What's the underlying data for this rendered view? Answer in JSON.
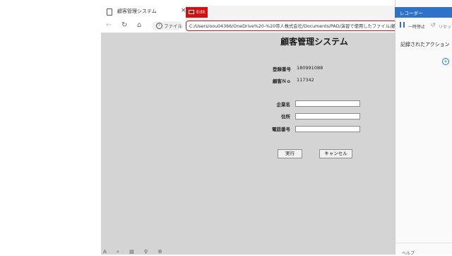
{
  "browser": {
    "tab_title": "顧客管理システム",
    "tab_close_glyph": "×",
    "edit_label": "Edit",
    "file_label": "ファイル",
    "info_glyph": "i",
    "address": "C:/Users/oou04366/OneDrive%20-%20帝人株式会社/Documents/PAD/演習で使用したファイル/顧",
    "back_glyph": "←",
    "reload_glyph": "↻",
    "home_glyph": "⌂"
  },
  "form": {
    "title": "顧客管理システム",
    "reg_number_label": "登録番号",
    "reg_number_value": "180991088",
    "customer_no_label": "顧客Ｎｏ",
    "customer_no_value": "117342",
    "company_label": "企業名",
    "company_value": "",
    "address_label": "住所",
    "address_value": "",
    "phone_label": "電話番号",
    "phone_value": "",
    "run_button": "実行",
    "cancel_button": "キャンセル"
  },
  "bottom_toolbar": {
    "icons": "A ⌕ ▤ ⚲ ⚙"
  },
  "recorder": {
    "title": "レコーダー",
    "pause_label": "一時停止",
    "reset_glyph": "↺",
    "reset_label": "リセット",
    "recorded_actions_label": "記録されたアクション",
    "add_glyph": "+",
    "footer": "ヘルプ"
  },
  "colors": {
    "accent_red": "#d30f0f",
    "recorder_blue": "#2f72c9",
    "page_gray": "#d4d4d4"
  }
}
